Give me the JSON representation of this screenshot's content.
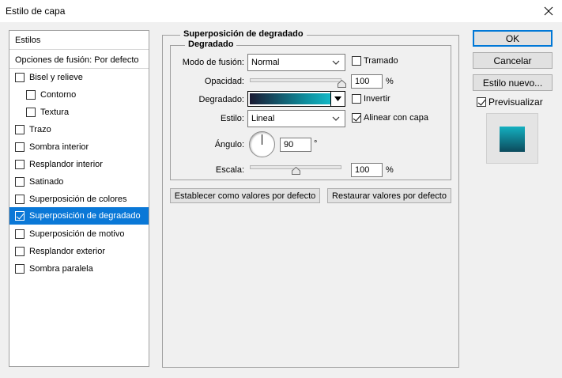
{
  "window": {
    "title": "Estilo de capa",
    "close_icon": "close-icon"
  },
  "styles_list": {
    "items": [
      {
        "label": "Estilos",
        "has_checkbox": false,
        "checked": false,
        "indent": false,
        "selected": false
      },
      {
        "label": "Opciones de fusión: Por defecto",
        "has_checkbox": false,
        "checked": false,
        "indent": false,
        "selected": false
      },
      {
        "label": "Bisel y relieve",
        "has_checkbox": true,
        "checked": false,
        "indent": false,
        "selected": false
      },
      {
        "label": "Contorno",
        "has_checkbox": true,
        "checked": false,
        "indent": true,
        "selected": false
      },
      {
        "label": "Textura",
        "has_checkbox": true,
        "checked": false,
        "indent": true,
        "selected": false
      },
      {
        "label": "Trazo",
        "has_checkbox": true,
        "checked": false,
        "indent": false,
        "selected": false
      },
      {
        "label": "Sombra interior",
        "has_checkbox": true,
        "checked": false,
        "indent": false,
        "selected": false
      },
      {
        "label": "Resplandor interior",
        "has_checkbox": true,
        "checked": false,
        "indent": false,
        "selected": false
      },
      {
        "label": "Satinado",
        "has_checkbox": true,
        "checked": false,
        "indent": false,
        "selected": false
      },
      {
        "label": "Superposición de colores",
        "has_checkbox": true,
        "checked": false,
        "indent": false,
        "selected": false
      },
      {
        "label": "Superposición de degradado",
        "has_checkbox": true,
        "checked": true,
        "indent": false,
        "selected": true
      },
      {
        "label": "Superposición de motivo",
        "has_checkbox": true,
        "checked": false,
        "indent": false,
        "selected": false
      },
      {
        "label": "Resplandor exterior",
        "has_checkbox": true,
        "checked": false,
        "indent": false,
        "selected": false
      },
      {
        "label": "Sombra paralela",
        "has_checkbox": true,
        "checked": false,
        "indent": false,
        "selected": false
      }
    ]
  },
  "panel": {
    "section_title": "Superposición de degradado",
    "group_title": "Degradado",
    "blend_mode": {
      "label": "Modo de fusión:",
      "value": "Normal"
    },
    "dither": {
      "label": "Tramado",
      "checked": false
    },
    "opacity": {
      "label": "Opacidad:",
      "value": "100",
      "unit": "%",
      "level": 1.0
    },
    "gradient": {
      "label": "Degradado:",
      "colors": [
        "#1a1a33",
        "#0e8f9e",
        "#14b8c6"
      ]
    },
    "reverse": {
      "label": "Invertir",
      "checked": false
    },
    "style": {
      "label": "Estilo:",
      "value": "Lineal"
    },
    "align_with_layer": {
      "label": "Alinear con capa",
      "checked": true
    },
    "angle": {
      "label": "Ángulo:",
      "value": "90",
      "unit": "°"
    },
    "scale": {
      "label": "Escala:",
      "value": "100",
      "unit": "%",
      "level": 0.5
    },
    "set_default_button": "Establecer como valores por defecto",
    "reset_default_button": "Restaurar valores por defecto"
  },
  "actions": {
    "ok": "OK",
    "cancel": "Cancelar",
    "new_style": "Estilo nuevo...",
    "preview": {
      "label": "Previsualizar",
      "checked": true
    }
  },
  "colors": {
    "selection": "#0a78d7",
    "accent_border": "#0078d7",
    "preview_top": "#14b0c0",
    "preview_bottom": "#0c4a5c"
  }
}
